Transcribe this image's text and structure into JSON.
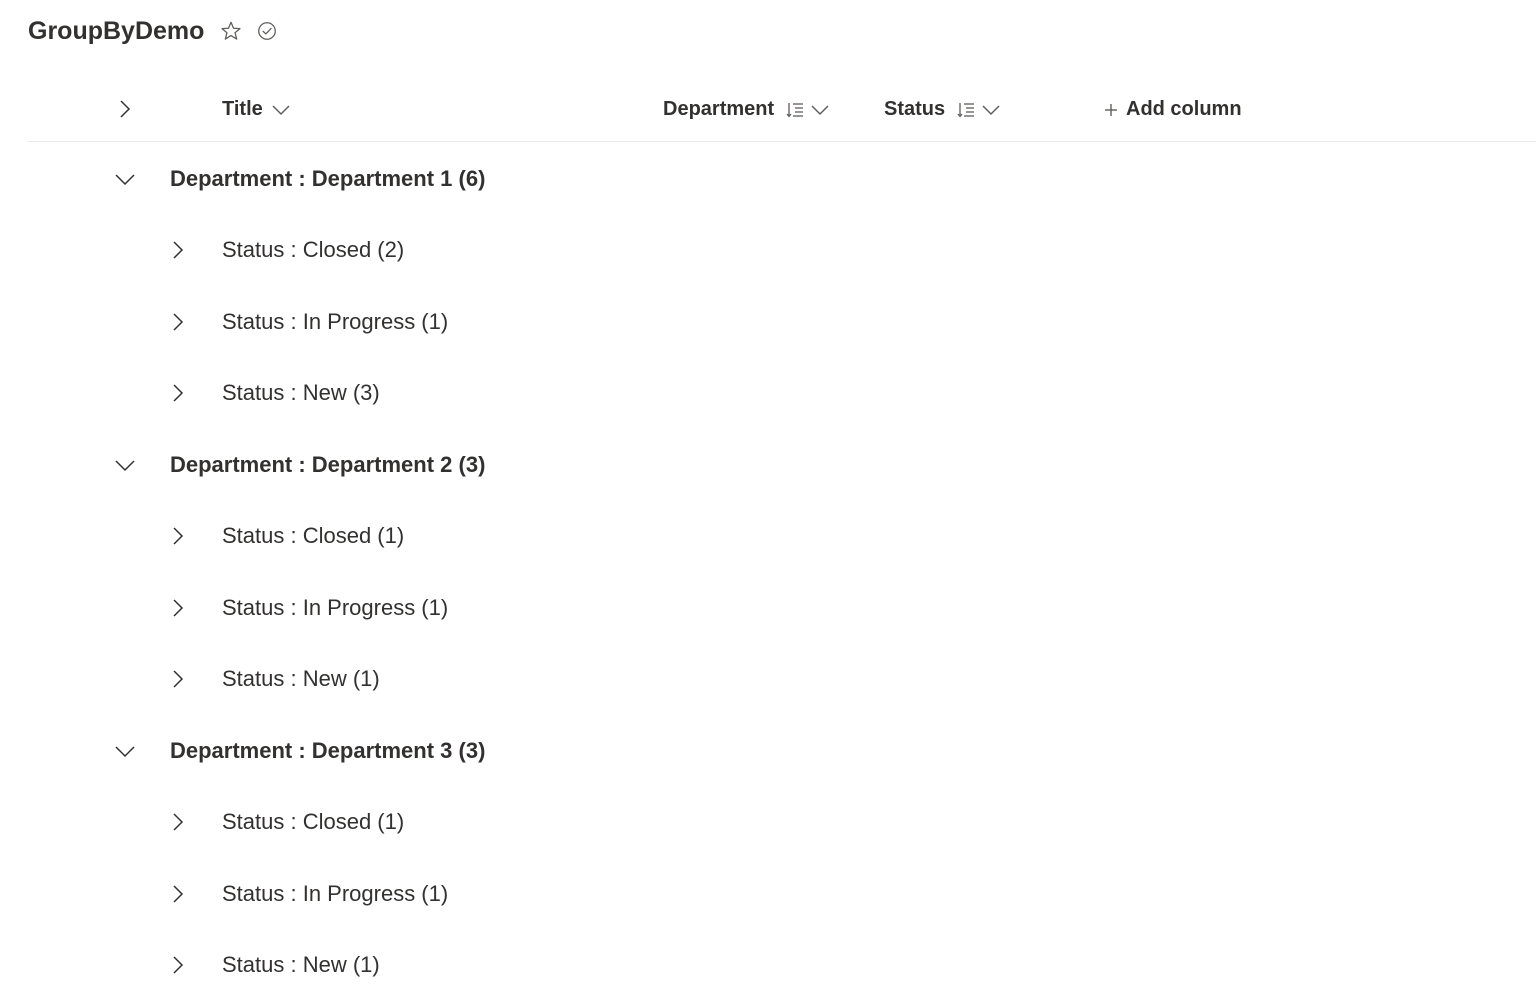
{
  "list": {
    "title": "GroupByDemo",
    "favorite_icon": "star-icon",
    "status_icon": "check-circle-icon"
  },
  "columns": {
    "title": "Title",
    "department": "Department",
    "status": "Status",
    "add_column": "Add column"
  },
  "groups": [
    {
      "label": "Department : Department 1 (6)",
      "expanded": true,
      "subgroups": [
        {
          "label": "Status : Closed (2)"
        },
        {
          "label": "Status : In Progress (1)"
        },
        {
          "label": "Status : New (3)"
        }
      ]
    },
    {
      "label": "Department : Department 2 (3)",
      "expanded": true,
      "subgroups": [
        {
          "label": "Status : Closed (1)"
        },
        {
          "label": "Status : In Progress (1)"
        },
        {
          "label": "Status : New (1)"
        }
      ]
    },
    {
      "label": "Department : Department 3 (3)",
      "expanded": true,
      "subgroups": [
        {
          "label": "Status : Closed (1)"
        },
        {
          "label": "Status : In Progress (1)"
        },
        {
          "label": "Status : New (1)"
        }
      ]
    }
  ]
}
